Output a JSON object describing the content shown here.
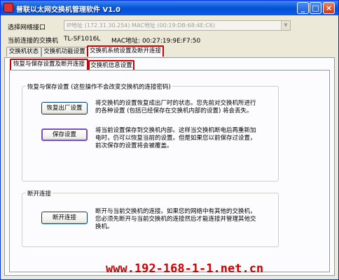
{
  "window": {
    "title": "普联以太网交换机管理软件 V1.0"
  },
  "titlebar_buttons": {
    "minimize": "_",
    "maximize": "□",
    "close": "×"
  },
  "network_select": {
    "label": "选择网络接口",
    "value": "IP地址 (172.31.30.254)     MAC地址 (00:19:DB:68:4E:C6)"
  },
  "connected_switch": {
    "label": "当前连接的交换机",
    "model": "TL-SF1016L",
    "mac": "MAC地址: 00:27:19:9E:F7:50"
  },
  "main_tabs": [
    {
      "label": "交换机状态"
    },
    {
      "label": "交换机功能设置"
    },
    {
      "label": "交换机系统设置及断开连接"
    }
  ],
  "sub_tabs": [
    {
      "label": "恢复与保存设置及断开连接"
    },
    {
      "label": "交换机信息设置"
    }
  ],
  "restore_group": {
    "title": "恢复与保存设置 (这些操作不会改变交换机的连接密码)",
    "factory_button": "恢复出厂设置",
    "factory_desc": "将交换机的设置恢复成出厂时的状态。您先前对交换机所进行的各种设置 (包括已经保存在交换机内部的设置) 将会丢失。",
    "save_button": "保存设置",
    "save_desc": "将当前设置保存到交换机内部。这样当交换机断电后再重新加电时，仍可以恢复当前的设置。但是如果您以前保存过设置，前次保存的设置将会被覆盖。"
  },
  "disconnect_group": {
    "title": "断开连接",
    "button": "断开连接",
    "desc": "断开与当前交换机的连接。如果您的网络中有其他的交换机，您必须先断开与当前交换机的连接然后才能连接并管理其他交换机。"
  },
  "watermark": "www.192-168-1-1.net.cn"
}
